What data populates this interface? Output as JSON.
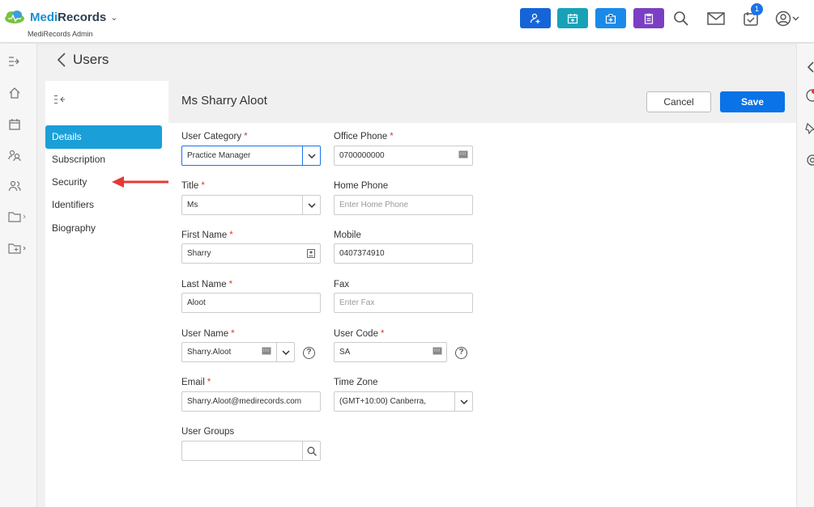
{
  "brand": {
    "name_part1": "Medi",
    "name_part2": "Records",
    "subtitle": "MediRecords Admin"
  },
  "header": {
    "notification_count": "1"
  },
  "page": {
    "back_label": "Users",
    "title": "Ms Sharry Aloot"
  },
  "subnav": {
    "items": [
      "Details",
      "Subscription",
      "Security",
      "Identifiers",
      "Biography"
    ],
    "active": "Details"
  },
  "actions": {
    "cancel": "Cancel",
    "save": "Save"
  },
  "form": {
    "user_category": {
      "label": "User Category",
      "value": "Practice Manager"
    },
    "office_phone": {
      "label": "Office Phone",
      "value": "0700000000"
    },
    "title": {
      "label": "Title",
      "value": "Ms"
    },
    "home_phone": {
      "label": "Home Phone",
      "placeholder": "Enter Home Phone"
    },
    "first_name": {
      "label": "First Name",
      "value": "Sharry"
    },
    "mobile": {
      "label": "Mobile",
      "value": "0407374910"
    },
    "last_name": {
      "label": "Last Name",
      "value": "Aloot"
    },
    "fax": {
      "label": "Fax",
      "placeholder": "Enter Fax"
    },
    "user_name": {
      "label": "User Name",
      "value": "Sharry.Aloot"
    },
    "user_code": {
      "label": "User Code",
      "value": "SA"
    },
    "email": {
      "label": "Email",
      "value": "Sharry.Aloot@medirecords.com"
    },
    "time_zone": {
      "label": "Time Zone",
      "value": "(GMT+10:00) Canberra,"
    },
    "user_groups": {
      "label": "User Groups",
      "value": ""
    }
  },
  "colors": {
    "accent": "#0a73e8",
    "active_nav": "#1a9fd9",
    "required": "#e53935",
    "annotation_arrow": "#e53935"
  },
  "icons": [
    "cloud-logo-icon",
    "add-patient-icon",
    "appointment-icon",
    "medical-kit-icon",
    "clipboard-icon",
    "search-icon",
    "mail-icon",
    "tasks-icon",
    "user-account-icon"
  ]
}
